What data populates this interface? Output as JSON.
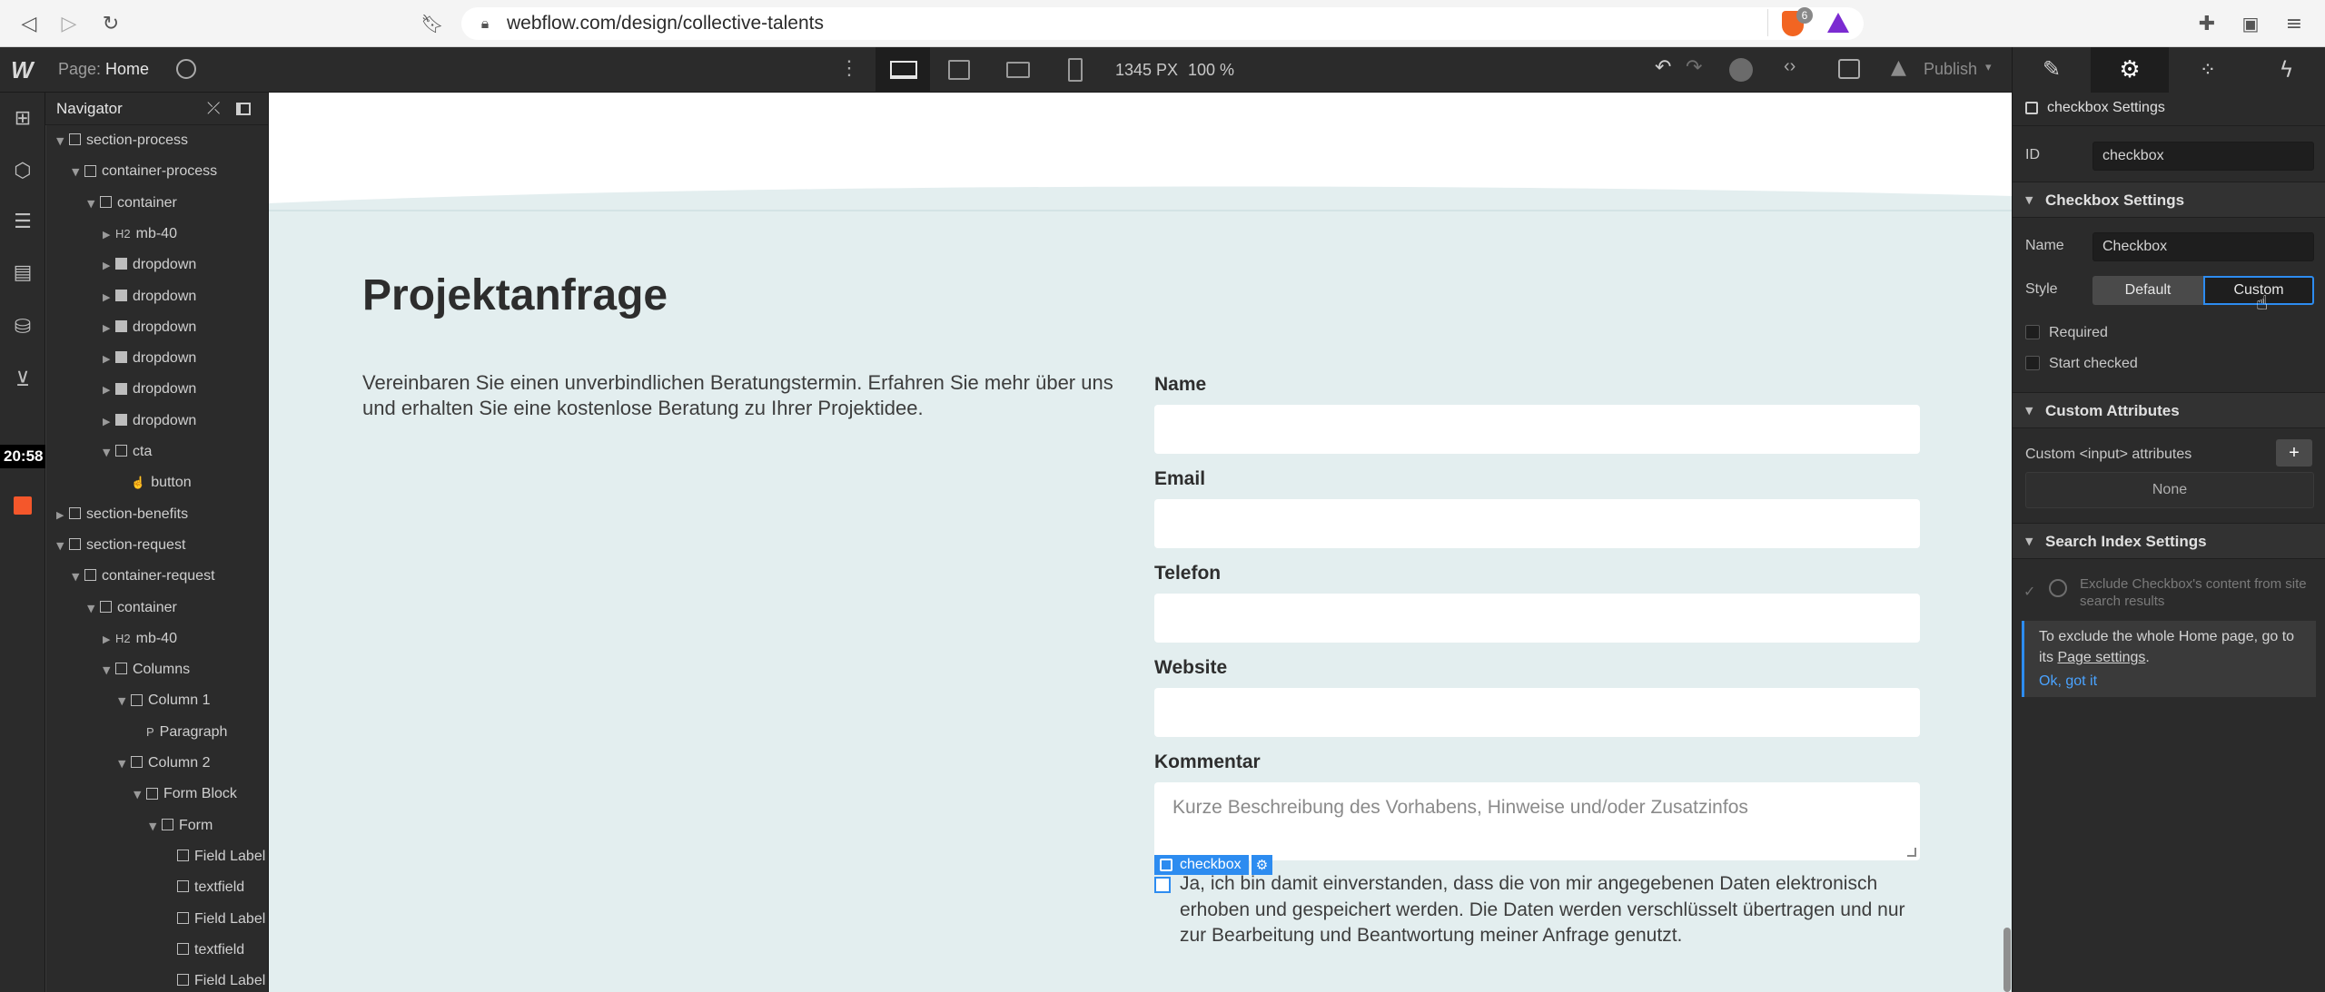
{
  "browser": {
    "url": "webflow.com/design/collective-talents",
    "shield_badge": "6"
  },
  "topbar": {
    "page_label": "Page:",
    "page_name": "Home",
    "width_px": "1345 PX",
    "zoom": "100 %",
    "publish_label": "Publish"
  },
  "clock": "20:58",
  "navigator": {
    "title": "Navigator",
    "items": [
      {
        "label": "section-process",
        "depth": 0,
        "arrow": "down",
        "icon": "section"
      },
      {
        "label": "container-process",
        "depth": 1,
        "arrow": "down",
        "icon": "box"
      },
      {
        "label": "container",
        "depth": 2,
        "arrow": "down",
        "icon": "container"
      },
      {
        "label": "mb-40",
        "depth": 3,
        "arrow": "right",
        "icon": "heading"
      },
      {
        "label": "dropdown",
        "depth": 3,
        "arrow": "right",
        "icon": "dropdown"
      },
      {
        "label": "dropdown",
        "depth": 3,
        "arrow": "right",
        "icon": "dropdown"
      },
      {
        "label": "dropdown",
        "depth": 3,
        "arrow": "right",
        "icon": "dropdown"
      },
      {
        "label": "dropdown",
        "depth": 3,
        "arrow": "right",
        "icon": "dropdown"
      },
      {
        "label": "dropdown",
        "depth": 3,
        "arrow": "right",
        "icon": "dropdown"
      },
      {
        "label": "dropdown",
        "depth": 3,
        "arrow": "right",
        "icon": "dropdown"
      },
      {
        "label": "cta",
        "depth": 3,
        "arrow": "down",
        "icon": "box"
      },
      {
        "label": "button",
        "depth": 4,
        "arrow": "",
        "icon": "hand"
      },
      {
        "label": "section-benefits",
        "depth": 0,
        "arrow": "right",
        "icon": "section"
      },
      {
        "label": "section-request",
        "depth": 0,
        "arrow": "down",
        "icon": "section"
      },
      {
        "label": "container-request",
        "depth": 1,
        "arrow": "down",
        "icon": "box"
      },
      {
        "label": "container",
        "depth": 2,
        "arrow": "down",
        "icon": "container"
      },
      {
        "label": "mb-40",
        "depth": 3,
        "arrow": "right",
        "icon": "heading"
      },
      {
        "label": "Columns",
        "depth": 3,
        "arrow": "down",
        "icon": "columns"
      },
      {
        "label": "Column 1",
        "depth": 4,
        "arrow": "down",
        "icon": "container"
      },
      {
        "label": "Paragraph",
        "depth": 5,
        "arrow": "",
        "icon": "paragraph"
      },
      {
        "label": "Column 2",
        "depth": 4,
        "arrow": "down",
        "icon": "container"
      },
      {
        "label": "Form Block",
        "depth": 5,
        "arrow": "down",
        "icon": "form"
      },
      {
        "label": "Form",
        "depth": 6,
        "arrow": "down",
        "icon": "box"
      },
      {
        "label": "Field Label",
        "depth": 7,
        "arrow": "",
        "icon": "label"
      },
      {
        "label": "textfield",
        "depth": 7,
        "arrow": "",
        "icon": "box"
      },
      {
        "label": "Field Label",
        "depth": 7,
        "arrow": "",
        "icon": "label"
      },
      {
        "label": "textfield",
        "depth": 7,
        "arrow": "",
        "icon": "box"
      },
      {
        "label": "Field Label",
        "depth": 7,
        "arrow": "",
        "icon": "label"
      }
    ]
  },
  "canvas": {
    "heading": "Projektanfrage",
    "intro": "Vereinbaren Sie einen unverbindlichen Beratungstermin. Erfahren Sie mehr über uns und erhalten Sie eine kostenlose Beratung zu Ihrer Projektidee.",
    "fields": [
      {
        "label": "Name"
      },
      {
        "label": "Email"
      },
      {
        "label": "Telefon"
      },
      {
        "label": "Website"
      }
    ],
    "comment_label": "Kommentar",
    "comment_placeholder": "Kurze Beschreibung des Vorhabens, Hinweise und/oder Zusatzinfos",
    "checkbox_tag": "checkbox",
    "consent_text": "Ja, ich bin damit einverstanden, dass die von mir angegebenen Daten elektronisch erhoben und gespeichert werden. Die Daten werden verschlüsselt übertragen und nur zur Bearbeitung und Beantwortung meiner Anfrage genutzt."
  },
  "settings": {
    "element_title": "checkbox Settings",
    "id_label": "ID",
    "id_value": "checkbox",
    "checkbox_settings_title": "Checkbox Settings",
    "name_label": "Name",
    "name_value": "Checkbox",
    "style_label": "Style",
    "style_default": "Default",
    "style_custom": "Custom",
    "required_label": "Required",
    "start_checked_label": "Start checked",
    "custom_attributes_title": "Custom Attributes",
    "custom_input_label": "Custom <input> attributes",
    "none_label": "None",
    "search_index_title": "Search Index Settings",
    "exclude_label": "Exclude Checkbox's content from site search results",
    "info_text_1": "To exclude the whole Home page, go to its",
    "info_link": "Page settings",
    "info_text_2": ".",
    "ok_link": "Ok, got it"
  },
  "colors": {
    "accent": "#2d8cf0",
    "canvas_bg": "#e3eeef",
    "panel_bg": "#2b2b2b"
  }
}
